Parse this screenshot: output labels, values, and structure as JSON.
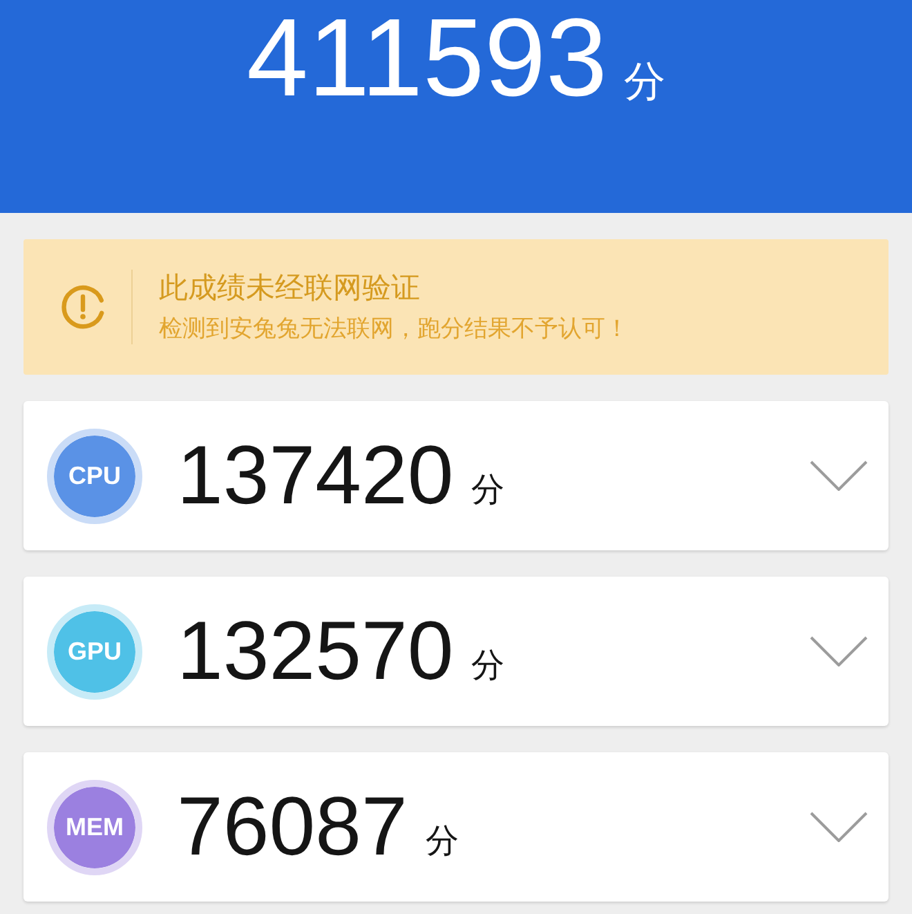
{
  "header": {
    "total_score": "411593",
    "unit": "分"
  },
  "notice": {
    "title": "此成绩未经联网验证",
    "message": "检测到安兔兔无法联网，跑分结果不予认可！"
  },
  "results": [
    {
      "badge": "CPU",
      "color": "#5a92e6",
      "score": "137420",
      "unit": "分",
      "expanded": false
    },
    {
      "badge": "GPU",
      "color": "#4fc1e7",
      "score": "132570",
      "unit": "分",
      "expanded": false
    },
    {
      "badge": "MEM",
      "color": "#9b80e0",
      "score": "76087",
      "unit": "分",
      "expanded": false
    }
  ]
}
